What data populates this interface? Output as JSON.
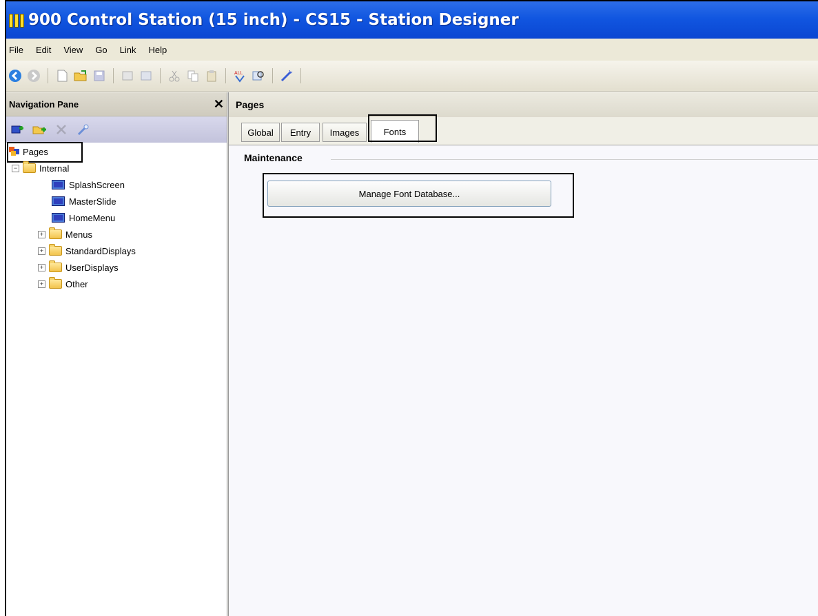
{
  "window": {
    "title": "900 Control Station (15 inch) - CS15 - Station Designer"
  },
  "menu": [
    "File",
    "Edit",
    "View",
    "Go",
    "Link",
    "Help"
  ],
  "toolbar_icons": [
    "back-icon",
    "forward-icon",
    "new-icon",
    "open-icon",
    "save-icon",
    "undo-icon",
    "redo-icon",
    "cut-icon",
    "copy-icon",
    "paste-icon",
    "find-icon",
    "zoom-icon",
    "wand-icon"
  ],
  "nav": {
    "title": "Navigation Pane",
    "close": "✕",
    "root": "Pages",
    "tree": [
      {
        "label": "Internal",
        "type": "folder",
        "expanded": true
      },
      {
        "label": "SplashScreen",
        "type": "page"
      },
      {
        "label": "MasterSlide",
        "type": "page"
      },
      {
        "label": "HomeMenu",
        "type": "page"
      },
      {
        "label": "Menus",
        "type": "folder",
        "expanded": false
      },
      {
        "label": "StandardDisplays",
        "type": "folder",
        "expanded": false
      },
      {
        "label": "UserDisplays",
        "type": "folder",
        "expanded": false
      },
      {
        "label": "Other",
        "type": "folder",
        "expanded": false
      }
    ]
  },
  "main": {
    "header": "Pages",
    "tabs": [
      "Global",
      "Entry",
      "Images",
      "Fonts"
    ],
    "active_tab": "Fonts",
    "section": "Maintenance",
    "button": "Manage Font Database..."
  },
  "colors": {
    "titlebar": "#0a46d2",
    "nav_toolbar": "#c3c3dc"
  }
}
